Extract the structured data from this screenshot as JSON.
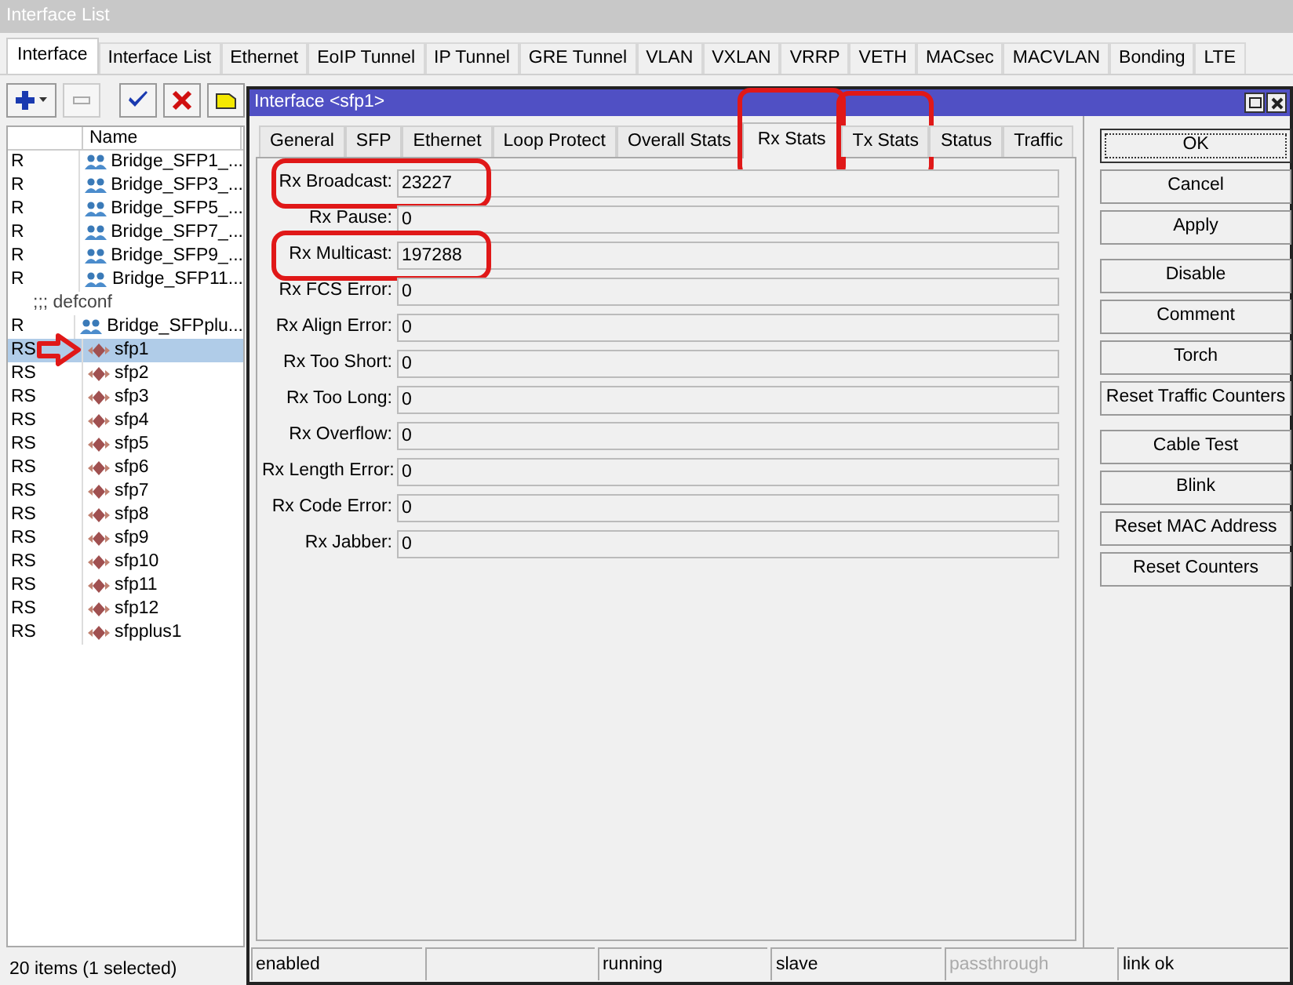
{
  "window": {
    "title": "Interface List"
  },
  "tabs": [
    {
      "label": "Interface",
      "selected": true
    },
    {
      "label": "Interface List",
      "selected": false
    },
    {
      "label": "Ethernet",
      "selected": false
    },
    {
      "label": "EoIP Tunnel",
      "selected": false
    },
    {
      "label": "IP Tunnel",
      "selected": false
    },
    {
      "label": "GRE Tunnel",
      "selected": false
    },
    {
      "label": "VLAN",
      "selected": false
    },
    {
      "label": "VXLAN",
      "selected": false
    },
    {
      "label": "VRRP",
      "selected": false
    },
    {
      "label": "VETH",
      "selected": false
    },
    {
      "label": "MACsec",
      "selected": false
    },
    {
      "label": "MACVLAN",
      "selected": false
    },
    {
      "label": "Bonding",
      "selected": false
    },
    {
      "label": "LTE",
      "selected": false
    }
  ],
  "toolbar": [
    {
      "kind": "add"
    },
    {
      "kind": "remove",
      "disabled": true
    },
    {
      "kind": "enable",
      "disabled": false
    },
    {
      "kind": "disable",
      "disabled": false
    },
    {
      "kind": "comment",
      "disabled": false
    }
  ],
  "table": {
    "columns": [
      "Name"
    ],
    "rows": [
      {
        "kind": "bridge",
        "flags": "R",
        "name": "Bridge_SFP1_...",
        "selected": false,
        "arrow": false
      },
      {
        "kind": "bridge",
        "flags": "R",
        "name": "Bridge_SFP3_...",
        "selected": false,
        "arrow": false
      },
      {
        "kind": "bridge",
        "flags": "R",
        "name": "Bridge_SFP5_...",
        "selected": false,
        "arrow": false
      },
      {
        "kind": "bridge",
        "flags": "R",
        "name": "Bridge_SFP7_...",
        "selected": false,
        "arrow": false
      },
      {
        "kind": "bridge",
        "flags": "R",
        "name": "Bridge_SFP9_...",
        "selected": false,
        "arrow": false
      },
      {
        "kind": "bridge",
        "flags": "R",
        "name": "Bridge_SFP11...",
        "selected": false,
        "arrow": false
      },
      {
        "kind": "comment",
        "text": ";;; defconf"
      },
      {
        "kind": "bridge",
        "flags": "R",
        "name": "Bridge_SFPplu...",
        "selected": false,
        "arrow": false
      },
      {
        "kind": "ether",
        "flags": "RS",
        "name": "sfp1",
        "selected": true,
        "arrow": true
      },
      {
        "kind": "ether",
        "flags": "RS",
        "name": "sfp2",
        "selected": false,
        "arrow": false
      },
      {
        "kind": "ether",
        "flags": "RS",
        "name": "sfp3",
        "selected": false,
        "arrow": false
      },
      {
        "kind": "ether",
        "flags": "RS",
        "name": "sfp4",
        "selected": false,
        "arrow": false
      },
      {
        "kind": "ether",
        "flags": "RS",
        "name": "sfp5",
        "selected": false,
        "arrow": false
      },
      {
        "kind": "ether",
        "flags": "RS",
        "name": "sfp6",
        "selected": false,
        "arrow": false
      },
      {
        "kind": "ether",
        "flags": "RS",
        "name": "sfp7",
        "selected": false,
        "arrow": false
      },
      {
        "kind": "ether",
        "flags": "RS",
        "name": "sfp8",
        "selected": false,
        "arrow": false
      },
      {
        "kind": "ether",
        "flags": "RS",
        "name": "sfp9",
        "selected": false,
        "arrow": false
      },
      {
        "kind": "ether",
        "flags": "RS",
        "name": "sfp10",
        "selected": false,
        "arrow": false
      },
      {
        "kind": "ether",
        "flags": "RS",
        "name": "sfp11",
        "selected": false,
        "arrow": false
      },
      {
        "kind": "ether",
        "flags": "RS",
        "name": "sfp12",
        "selected": false,
        "arrow": false
      },
      {
        "kind": "ether",
        "flags": "RS",
        "name": "sfpplus1",
        "selected": false,
        "arrow": false
      }
    ],
    "footer": "20 items (1 selected)"
  },
  "dialog": {
    "title": "Interface <sfp1>",
    "tabs": [
      {
        "label": "General",
        "selected": false,
        "highlighted": false
      },
      {
        "label": "SFP",
        "selected": false,
        "highlighted": false
      },
      {
        "label": "Ethernet",
        "selected": false,
        "highlighted": false
      },
      {
        "label": "Loop Protect",
        "selected": false,
        "highlighted": false
      },
      {
        "label": "Overall Stats",
        "selected": false,
        "highlighted": false
      },
      {
        "label": "Rx Stats",
        "selected": true,
        "highlighted": true
      },
      {
        "label": "Tx Stats",
        "selected": false,
        "highlighted": true
      },
      {
        "label": "Status",
        "selected": false,
        "highlighted": false
      },
      {
        "label": "Traffic",
        "selected": false,
        "highlighted": false
      }
    ],
    "fields": [
      {
        "label": "Rx Broadcast:",
        "value": "23227",
        "highlighted": true
      },
      {
        "label": "Rx Pause:",
        "value": "0",
        "highlighted": false
      },
      {
        "label": "Rx Multicast:",
        "value": "197288",
        "highlighted": true
      },
      {
        "label": "Rx FCS Error:",
        "value": "0",
        "highlighted": false
      },
      {
        "label": "Rx Align Error:",
        "value": "0",
        "highlighted": false
      },
      {
        "label": "Rx Too Short:",
        "value": "0",
        "highlighted": false
      },
      {
        "label": "Rx Too Long:",
        "value": "0",
        "highlighted": false
      },
      {
        "label": "Rx Overflow:",
        "value": "0",
        "highlighted": false
      },
      {
        "label": "Rx Length Error:",
        "value": "0",
        "highlighted": false
      },
      {
        "label": "Rx Code Error:",
        "value": "0",
        "highlighted": false
      },
      {
        "label": "Rx Jabber:",
        "value": "0",
        "highlighted": false
      }
    ],
    "button_groups": [
      [
        {
          "label": "OK",
          "focused": true
        },
        {
          "label": "Cancel",
          "focused": false
        },
        {
          "label": "Apply",
          "focused": false
        }
      ],
      [
        {
          "label": "Disable",
          "focused": false
        },
        {
          "label": "Comment",
          "focused": false
        },
        {
          "label": "Torch",
          "focused": false
        },
        {
          "label": "Reset Traffic Counters",
          "focused": false
        }
      ],
      [
        {
          "label": "Cable Test",
          "focused": false
        },
        {
          "label": "Blink",
          "focused": false
        },
        {
          "label": "Reset MAC Address",
          "focused": false
        },
        {
          "label": "Reset Counters",
          "focused": false
        }
      ]
    ],
    "status_bar": [
      {
        "kind": "text",
        "text": "enabled",
        "disabled": false
      },
      {
        "kind": "blank"
      },
      {
        "kind": "text",
        "text": "running",
        "disabled": false
      },
      {
        "kind": "text",
        "text": "slave",
        "disabled": false
      },
      {
        "kind": "text",
        "text": "passthrough",
        "disabled": true
      },
      {
        "kind": "text",
        "text": "link ok",
        "disabled": false
      }
    ]
  }
}
